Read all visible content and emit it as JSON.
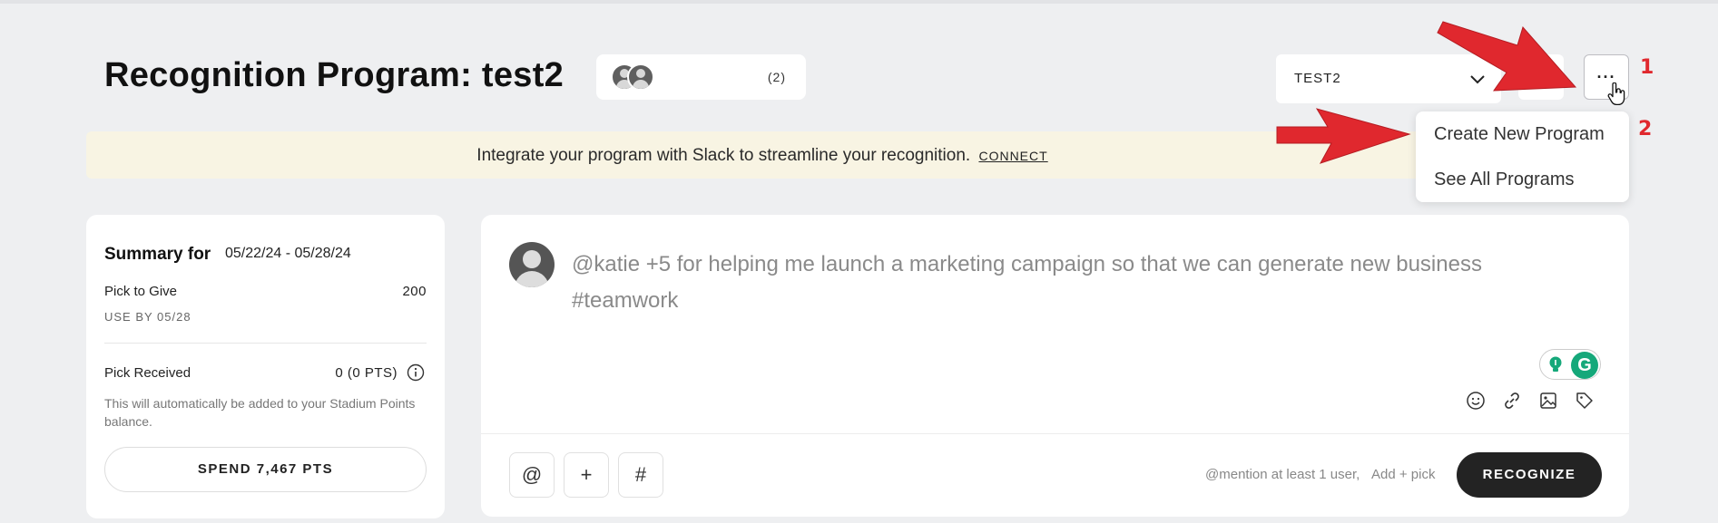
{
  "header": {
    "title": "Recognition Program: test2",
    "members_count": "(2)",
    "program_select_value": "TEST2",
    "more_label": "···"
  },
  "annotations": {
    "step1": "1",
    "step2": "2",
    "arrow_color": "#e0282e"
  },
  "banner": {
    "text": "Integrate your program with Slack to streamline your recognition.",
    "link": "CONNECT"
  },
  "dropdown_menu": {
    "items": [
      {
        "label": "Create New Program"
      },
      {
        "label": "See All Programs"
      }
    ]
  },
  "summary": {
    "title": "Summary for",
    "date_range": "05/22/24 - 05/28/24",
    "give_label": "Pick to Give",
    "give_value": "200",
    "use_by": "USE BY 05/28",
    "received_label": "Pick Received",
    "received_value": "0 (0 PTS)",
    "note": "This will automatically be added to your Stadium Points balance.",
    "spend_button": "SPEND 7,467 PTS"
  },
  "composer": {
    "placeholder": "@katie +5 for helping me launch a marketing campaign so that we can generate new business #teamwork",
    "toolbar_icons": [
      "emoji-icon",
      "link-icon",
      "image-icon",
      "tag-icon"
    ],
    "chip_buttons": [
      "@",
      "+",
      "#"
    ],
    "hint_mention": "@mention at least 1 user,",
    "hint_pick": "Add + pick",
    "recognize_button": "RECOGNIZE",
    "grammarly_letter": "G"
  },
  "colors": {
    "background": "#eeeff1",
    "banner": "#f8f4e3",
    "primary_button": "#232323",
    "grammarly": "#15a87a"
  }
}
